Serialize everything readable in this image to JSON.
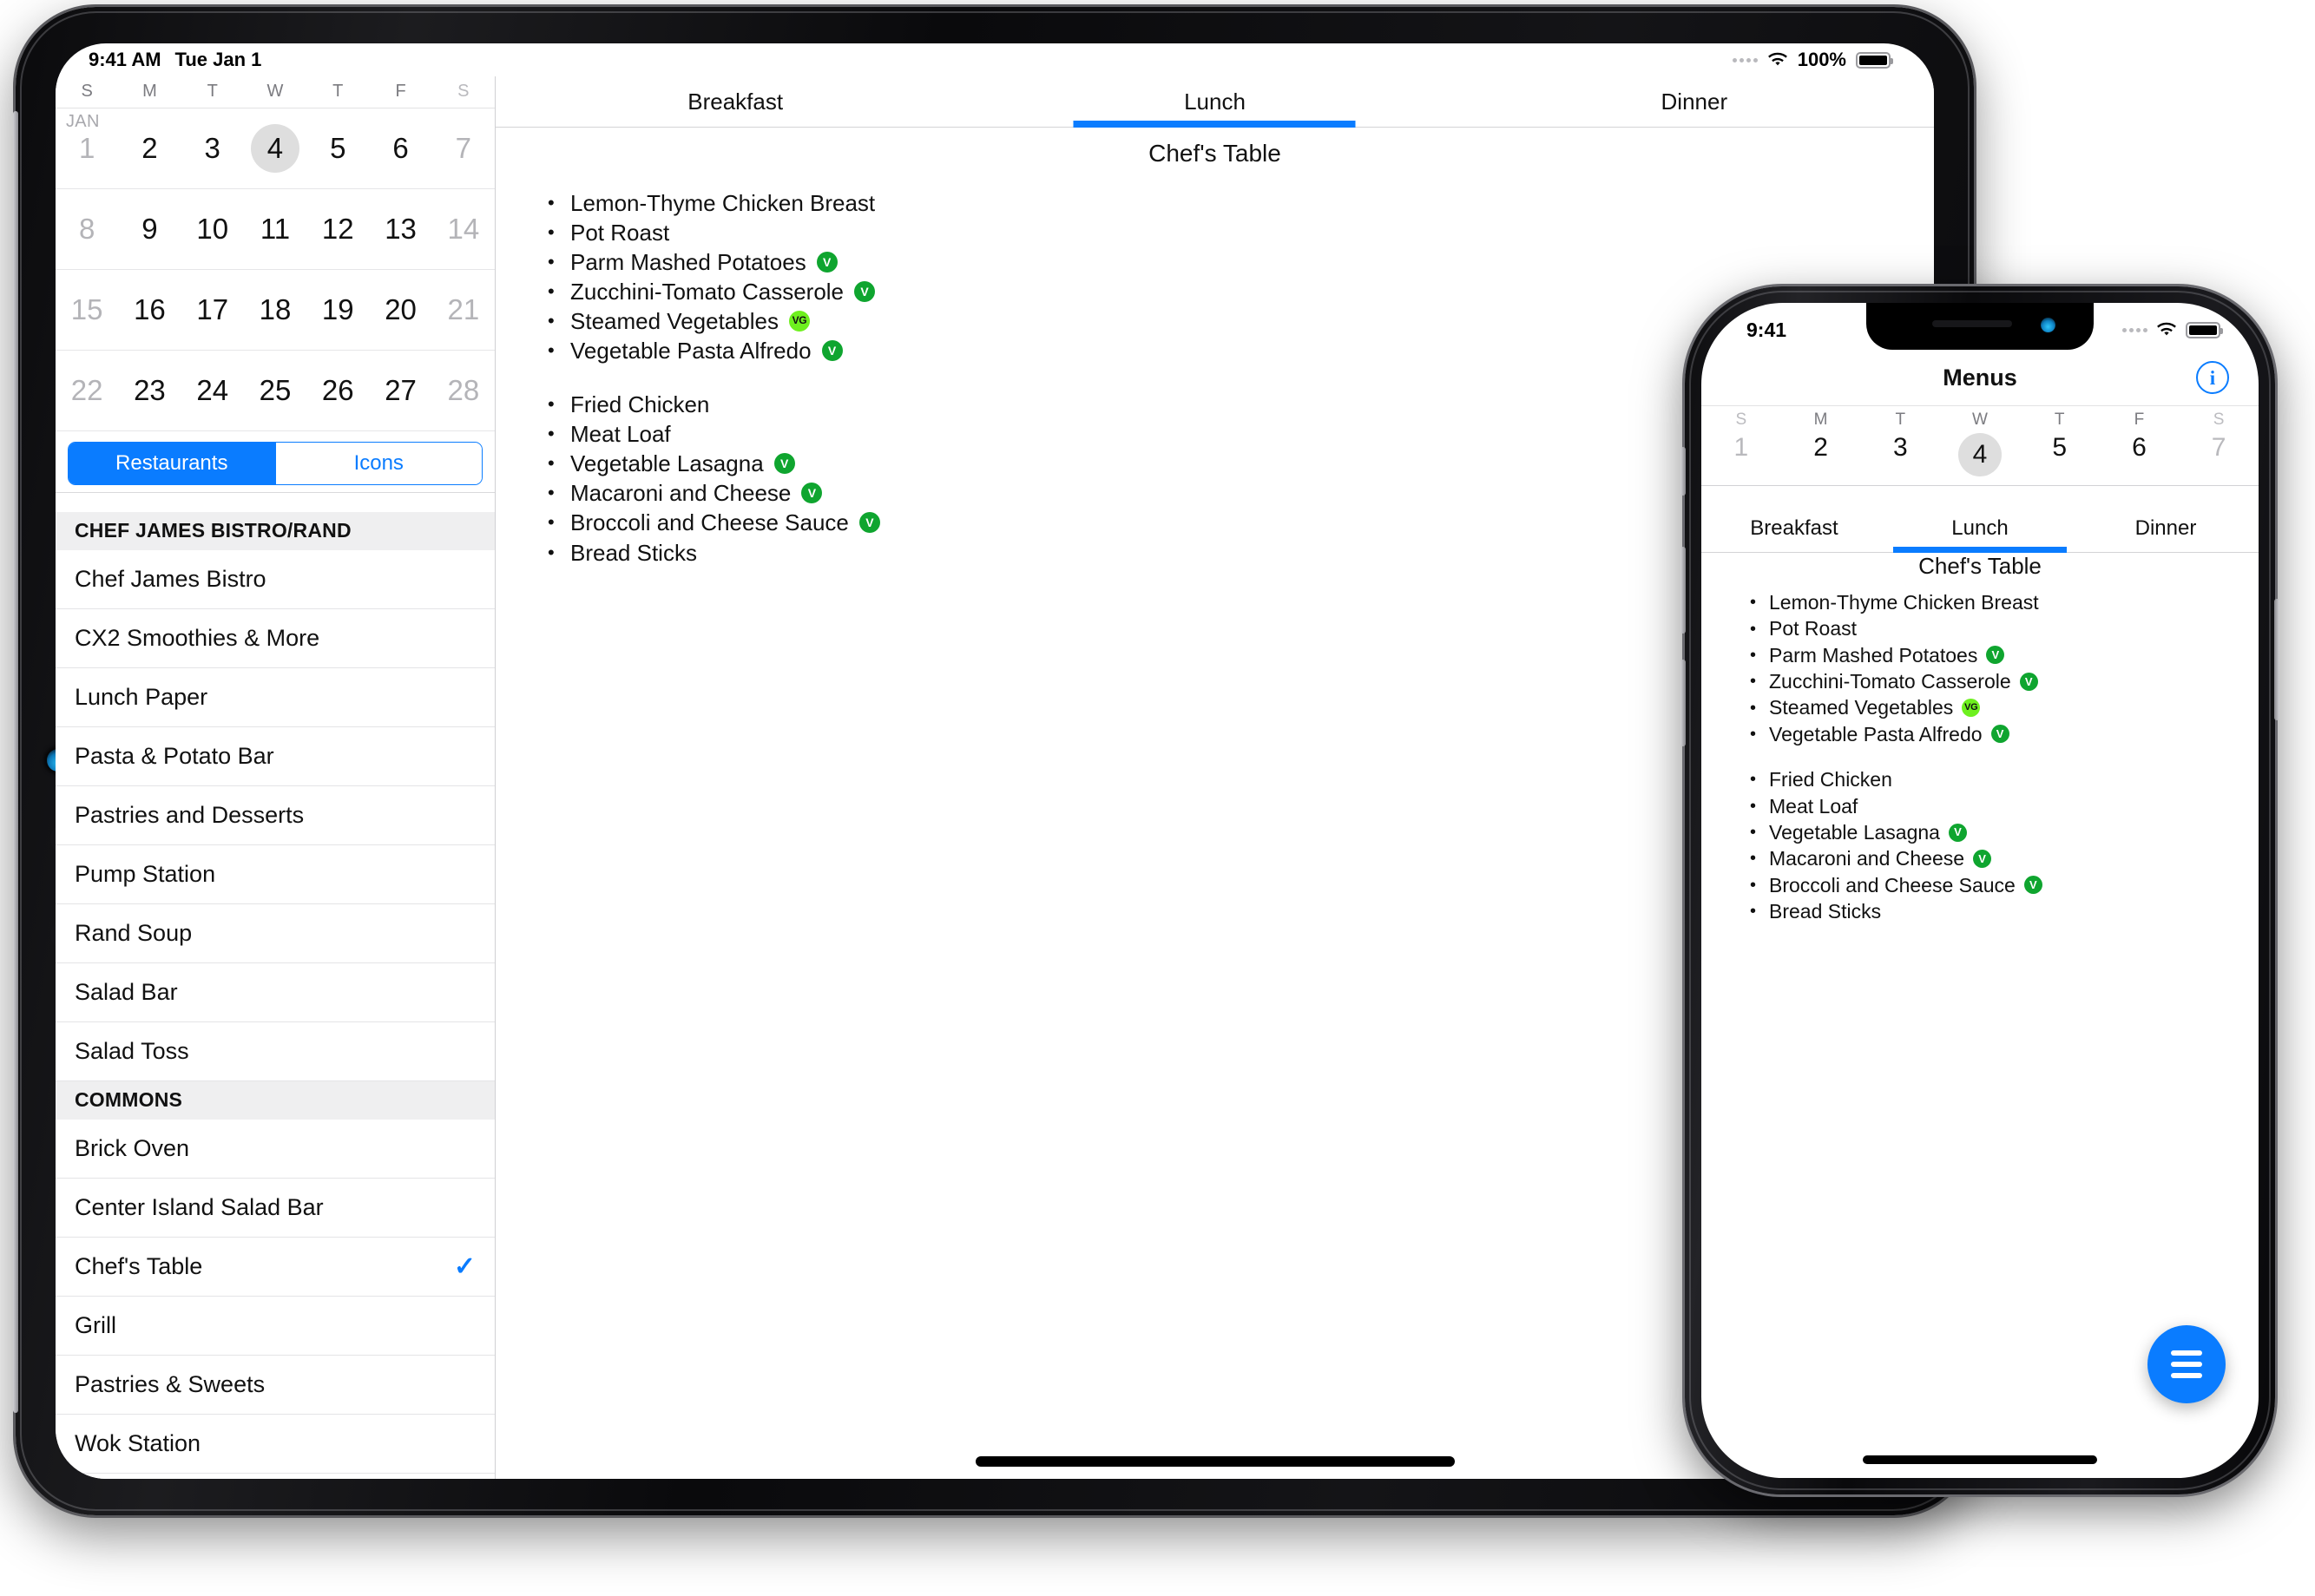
{
  "ipad": {
    "status": {
      "time": "9:41 AM",
      "date": "Tue Jan 1",
      "battery_percent": "100%",
      "wifi_icon": "wifi-icon",
      "signal_icon": "cellular-dots-icon",
      "battery_icon": "battery-full-icon"
    },
    "calendar": {
      "month_label": "JAN",
      "weekday_headers": [
        "S",
        "M",
        "T",
        "W",
        "T",
        "F",
        "S"
      ],
      "selected_day": "4",
      "rows": [
        [
          "1",
          "2",
          "3",
          "4",
          "5",
          "6",
          "7"
        ],
        [
          "8",
          "9",
          "10",
          "11",
          "12",
          "13",
          "14"
        ],
        [
          "15",
          "16",
          "17",
          "18",
          "19",
          "20",
          "21"
        ],
        [
          "22",
          "23",
          "24",
          "25",
          "26",
          "27",
          "28"
        ]
      ]
    },
    "segmented": {
      "options": [
        "Restaurants",
        "Icons"
      ],
      "selected": "Restaurants"
    },
    "sidebar_sections": [
      {
        "header": "CHEF JAMES BISTRO/RAND",
        "items": [
          {
            "label": "Chef James Bistro",
            "selected": false
          },
          {
            "label": "CX2 Smoothies & More",
            "selected": false
          },
          {
            "label": "Lunch Paper",
            "selected": false
          },
          {
            "label": "Pasta & Potato Bar",
            "selected": false
          },
          {
            "label": "Pastries and Desserts",
            "selected": false
          },
          {
            "label": "Pump Station",
            "selected": false
          },
          {
            "label": "Rand Soup",
            "selected": false
          },
          {
            "label": "Salad Bar",
            "selected": false
          },
          {
            "label": "Salad Toss",
            "selected": false
          }
        ]
      },
      {
        "header": "COMMONS",
        "items": [
          {
            "label": "Brick Oven",
            "selected": false
          },
          {
            "label": "Center Island Salad Bar",
            "selected": false
          },
          {
            "label": "Chef's Table",
            "selected": true
          },
          {
            "label": "Grill",
            "selected": false
          },
          {
            "label": "Pastries & Sweets",
            "selected": false
          },
          {
            "label": "Wok Station",
            "selected": false
          }
        ]
      }
    ],
    "checkmark_glyph": "✓",
    "meal_tabs": [
      "Breakfast",
      "Lunch",
      "Dinner"
    ],
    "meal_selected": "Lunch",
    "detail_title": "Chef's Table"
  },
  "menu": {
    "groups": [
      {
        "items": [
          {
            "name": "Lemon-Thyme Chicken Breast",
            "badge": ""
          },
          {
            "name": "Pot Roast",
            "badge": ""
          },
          {
            "name": "Parm Mashed Potatoes",
            "badge": "V"
          },
          {
            "name": "Zucchini-Tomato Casserole",
            "badge": "V"
          },
          {
            "name": "Steamed Vegetables",
            "badge": "VG"
          },
          {
            "name": "Vegetable Pasta Alfredo",
            "badge": "V"
          }
        ]
      },
      {
        "items": [
          {
            "name": "Fried Chicken",
            "badge": ""
          },
          {
            "name": "Meat Loaf",
            "badge": ""
          },
          {
            "name": "Vegetable Lasagna",
            "badge": "V"
          },
          {
            "name": "Macaroni and Cheese",
            "badge": "V"
          },
          {
            "name": "Broccoli and Cheese Sauce",
            "badge": "V"
          },
          {
            "name": "Bread Sticks",
            "badge": ""
          }
        ]
      }
    ],
    "bullet_glyph": "•"
  },
  "iphone": {
    "status": {
      "time": "9:41",
      "signal_icon": "cellular-dots-icon",
      "wifi_icon": "wifi-icon",
      "battery_icon": "battery-full-icon"
    },
    "nav_title": "Menus",
    "info_button_label": "i",
    "calendar": {
      "weekday_headers": [
        "S",
        "M",
        "T",
        "W",
        "T",
        "F",
        "S"
      ],
      "days": [
        "1",
        "2",
        "3",
        "4",
        "5",
        "6",
        "7"
      ],
      "selected_day": "4"
    },
    "meal_tabs": [
      "Breakfast",
      "Lunch",
      "Dinner"
    ],
    "meal_selected": "Lunch",
    "detail_title": "Chef's Table",
    "fab_icon": "hamburger-menu-icon"
  },
  "colors": {
    "accent_blue": "#0a7cff",
    "badge_v_bg": "#0fa52f",
    "badge_vg_bg": "#6ef01f",
    "selected_day_bg": "#dedede",
    "section_header_bg": "#efeff0"
  }
}
